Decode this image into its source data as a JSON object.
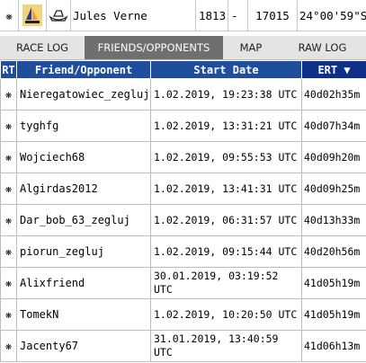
{
  "top_row": {
    "name": "Jules Verne",
    "number": "1813",
    "dash": "-",
    "value": "17015",
    "coordinate": "24°00'59\"S"
  },
  "tabs": [
    {
      "label": "RACE LOG",
      "active": false
    },
    {
      "label": "FRIENDS/OPPONENTS",
      "active": true
    },
    {
      "label": "MAP",
      "active": false
    },
    {
      "label": "RAW LOG",
      "active": false
    }
  ],
  "table": {
    "headers": {
      "rt": "RT",
      "friend": "Friend/Opponent",
      "start": "Start Date",
      "ert": "ERT ▼"
    },
    "rows": [
      {
        "name": "Nieregatowiec_zegluj",
        "date": "1.02.2019, 19:23:38 UTC",
        "ert": "40d02h35m"
      },
      {
        "name": "tyghfg",
        "date": "1.02.2019, 13:31:21 UTC",
        "ert": "40d07h34m"
      },
      {
        "name": "Wojciech68",
        "date": "1.02.2019, 09:55:53 UTC",
        "ert": "40d09h20m"
      },
      {
        "name": "Algirdas2012",
        "date": "1.02.2019, 13:41:31 UTC",
        "ert": "40d09h25m"
      },
      {
        "name": "Dar_bob_63_zegluj",
        "date": "1.02.2019, 06:31:57 UTC",
        "ert": "40d13h33m"
      },
      {
        "name": "piorun_zegluj",
        "date": "1.02.2019, 09:15:44 UTC",
        "ert": "40d20h56m"
      },
      {
        "name": "Alixfriend",
        "date": "30.01.2019, 03:19:52 UTC",
        "ert": "41d05h19m"
      },
      {
        "name": "TomekN",
        "date": "1.02.2019, 10:20:50 UTC",
        "ert": "41d05h19m"
      },
      {
        "name": "Jacenty67",
        "date": "31.01.2019, 13:40:59 UTC",
        "ert": "41d06h13m"
      }
    ]
  }
}
